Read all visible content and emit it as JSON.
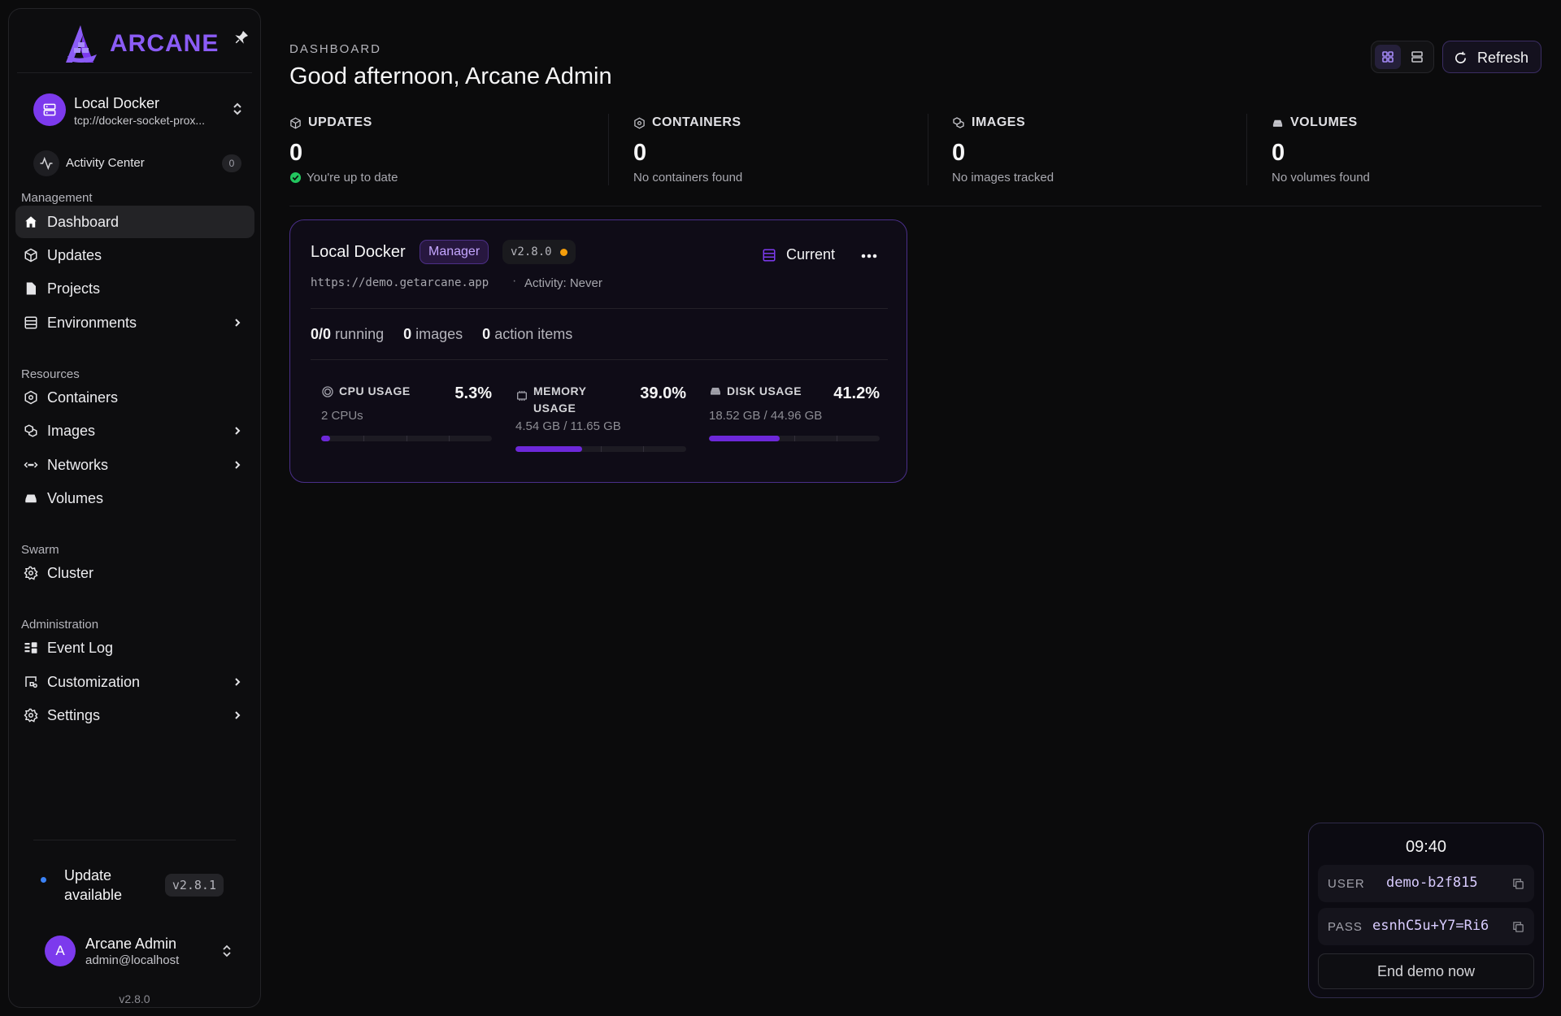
{
  "app": {
    "logo_text": "ARCANE"
  },
  "sidebar": {
    "environment": {
      "name": "Local Docker",
      "url": "tcp://docker-socket-prox..."
    },
    "activity": {
      "label": "Activity Center",
      "count": "0"
    },
    "sections": {
      "management": "Management",
      "resources": "Resources",
      "swarm": "Swarm",
      "administration": "Administration"
    },
    "items": {
      "dashboard": "Dashboard",
      "updates": "Updates",
      "projects": "Projects",
      "environments": "Environments",
      "containers": "Containers",
      "images": "Images",
      "networks": "Networks",
      "volumes": "Volumes",
      "cluster": "Cluster",
      "event_log": "Event Log",
      "customization": "Customization",
      "settings": "Settings"
    },
    "update": {
      "text": "Update available",
      "version": "v2.8.1"
    },
    "user": {
      "initial": "A",
      "name": "Arcane Admin",
      "email": "admin@localhost"
    },
    "version": "v2.8.0"
  },
  "header": {
    "eyebrow": "DASHBOARD",
    "greeting": "Good afternoon, Arcane Admin",
    "refresh_label": "Refresh"
  },
  "stats": {
    "updates": {
      "label": "UPDATES",
      "value": "0",
      "sub": "You're up to date"
    },
    "containers": {
      "label": "CONTAINERS",
      "value": "0",
      "sub": "No containers found"
    },
    "images": {
      "label": "IMAGES",
      "value": "0",
      "sub": "No images tracked"
    },
    "volumes": {
      "label": "VOLUMES",
      "value": "0",
      "sub": "No volumes found"
    }
  },
  "env_card": {
    "name": "Local Docker",
    "role_badge": "Manager",
    "version": "v2.8.0",
    "current_label": "Current",
    "url": "https://demo.getarcane.app",
    "separator": "·",
    "activity": "Activity: Never",
    "running_value": "0/0",
    "running_label": "running",
    "images_value": "0",
    "images_label": "images",
    "actions_value": "0",
    "actions_label": "action items",
    "metrics": {
      "cpu": {
        "label": "CPU USAGE",
        "percent": "5.3%",
        "fraction": 0.053,
        "sub": "2 CPUs"
      },
      "memory": {
        "label_line1": "MEMORY",
        "label_line2": "USAGE",
        "percent": "39.0%",
        "fraction": 0.39,
        "sub": "4.54 GB / 11.65 GB"
      },
      "disk": {
        "label": "DISK USAGE",
        "percent": "41.2%",
        "fraction": 0.412,
        "sub": "18.52 GB / 44.96 GB"
      }
    }
  },
  "demo": {
    "time": "09:40",
    "user_key": "USER",
    "user_value": "demo-b2f815",
    "pass_key": "PASS",
    "pass_value": "esnhC5u+Y7=Ri6",
    "end_label": "End demo now"
  },
  "colors": {
    "accent": "#8b5cf6",
    "accent_dark": "#6d28d9",
    "status_ok": "#22c55e",
    "status_warn": "#f59e0b",
    "update_dot": "#3b82f6"
  }
}
